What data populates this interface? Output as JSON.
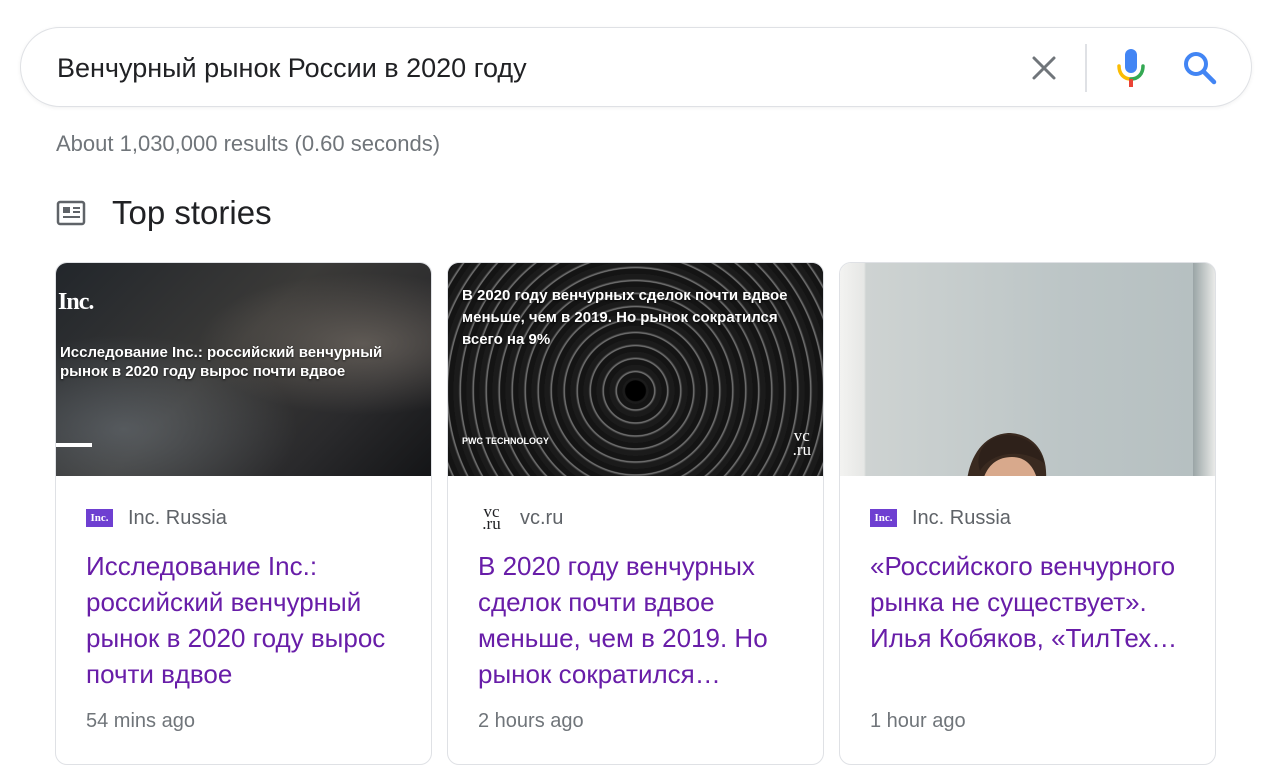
{
  "search": {
    "query": "Венчурный рынок России в 2020 году"
  },
  "results_stats": "About 1,030,000 results (0.60 seconds)",
  "section": {
    "title": "Top stories"
  },
  "colors": {
    "link_visited": "#681da8",
    "meta_gray": "#70757a",
    "inc_brand": "#6e3fd1",
    "google_blue": "#4285f4",
    "google_red": "#ea4335",
    "google_yellow": "#fbbc04",
    "google_green": "#34a853"
  },
  "stories": [
    {
      "source_logo": "Inc.",
      "source": "Inc. Russia",
      "title": "Исследование Inc.: российский венчурный рынок в 2020 году вырос почти вдвое",
      "time": "54 mins ago",
      "thumb": {
        "logo": "Inc.",
        "text": "Исследование Inc.: российский венчурный рынок в 2020 году вырос почти вдвое"
      }
    },
    {
      "source_logo": "vc\n.ru",
      "source": "vc.ru",
      "title": "В 2020 году венчурных сделок почти вдвое меньше, чем в 2019. Но рынок сократился…",
      "time": "2 hours ago",
      "thumb": {
        "text": "В 2020 году венчурных сделок почти вдвое меньше, чем в 2019. Но рынок сократился всего на 9%",
        "caption": "PWC TECHNOLOGY",
        "logo": "vc\n.ru"
      }
    },
    {
      "source_logo": "Inc.",
      "source": "Inc. Russia",
      "title": "«Российского венчурного рынка не существует». Илья Кобяков, «ТилТех…",
      "time": "1 hour ago"
    }
  ]
}
